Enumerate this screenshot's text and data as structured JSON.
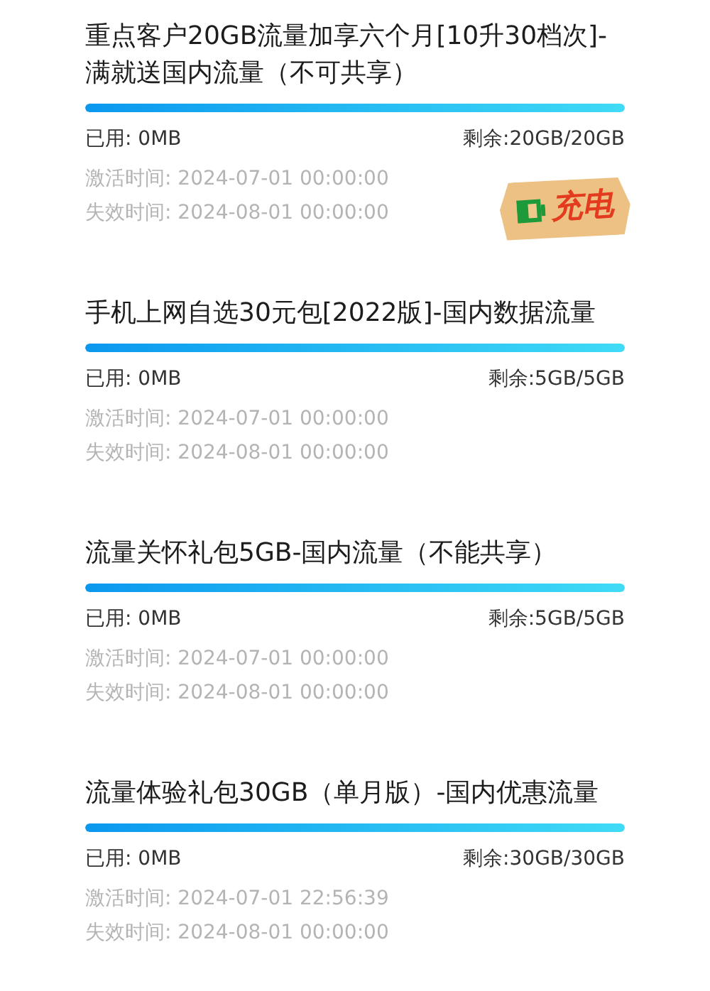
{
  "packages": [
    {
      "title": "重点客户20GB流量加享六个月[10升30档次]-满就送国内流量（不可共享）",
      "level": 1,
      "used": "已用: 0MB",
      "remaining": "剩余:20GB/20GB",
      "activated": "激活时间: 2024-07-01 00:00:00",
      "expires": "失效时间: 2024-08-01 00:00:00",
      "sticker": {
        "label": "充电"
      }
    },
    {
      "title": "手机上网自选30元包[2022版]-国内数据流量",
      "level": 1,
      "used": "已用: 0MB",
      "remaining": "剩余:5GB/5GB",
      "activated": "激活时间: 2024-07-01 00:00:00",
      "expires": "失效时间: 2024-08-01 00:00:00"
    },
    {
      "title": "流量关怀礼包5GB-国内流量（不能共享）",
      "level": 1,
      "used": "已用: 0MB",
      "remaining": "剩余:5GB/5GB",
      "activated": "激活时间: 2024-07-01 00:00:00",
      "expires": "失效时间: 2024-08-01 00:00:00"
    },
    {
      "title": "流量体验礼包30GB（单月版）-国内优惠流量",
      "level": 1,
      "used": "已用: 0MB",
      "remaining": "剩余:30GB/30GB",
      "activated": "激活时间: 2024-07-01 22:56:39",
      "expires": "失效时间: 2024-08-01 00:00:00"
    }
  ]
}
